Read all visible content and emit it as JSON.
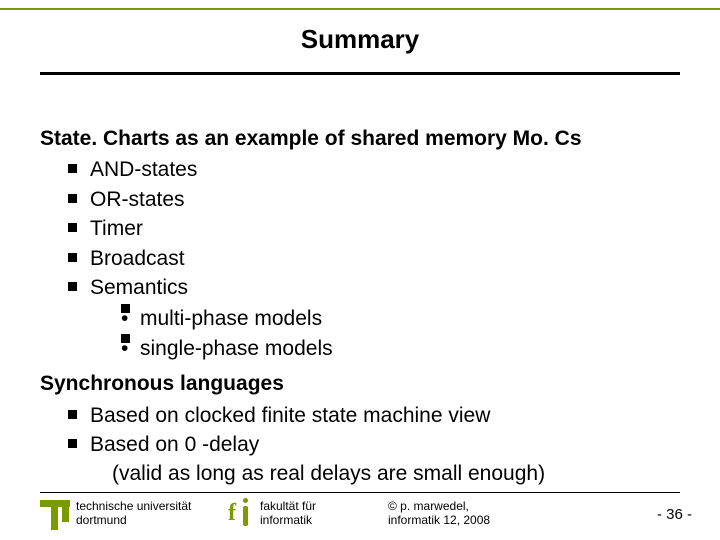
{
  "title": "Summary",
  "section1": {
    "heading": "State. Charts as an example of shared memory Mo. Cs",
    "items": [
      "AND-states",
      "OR-states",
      "Timer",
      "Broadcast",
      "Semantics"
    ],
    "sub": [
      "multi-phase models",
      "single-phase models"
    ]
  },
  "section2": {
    "heading": "Synchronous languages",
    "items": [
      "Based on clocked finite state machine view",
      "Based on 0 -delay"
    ],
    "paren": "(valid as long as real delays are small enough)"
  },
  "footer": {
    "uni_l1": "technische universität",
    "uni_l2": "dortmund",
    "fac_l1": "fakultät für",
    "fac_l2": "informatik",
    "cr_l1": "©  p. marwedel,",
    "cr_l2": "informatik 12,  2008",
    "page": "-  36 -"
  }
}
